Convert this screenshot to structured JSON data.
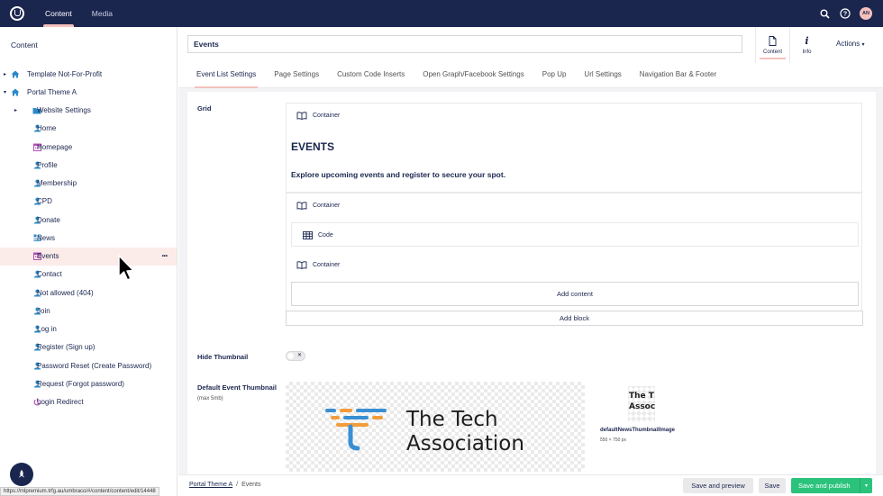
{
  "topbar": {
    "nav": [
      "Content",
      "Media"
    ],
    "avatar_initials": "AN",
    "icons": [
      "search-icon",
      "help-icon"
    ]
  },
  "sidebar": {
    "title": "Content",
    "items": [
      {
        "label": "Template Not-For-Profit",
        "icon": "home-icon",
        "level": 0,
        "caret": true
      },
      {
        "label": "Portal Theme A",
        "icon": "home-icon",
        "level": 0,
        "caret": true,
        "expanded": true
      },
      {
        "label": "Website Settings",
        "icon": "folder-icon",
        "level": 1,
        "caret": true
      },
      {
        "label": "Home",
        "icon": "user-icon",
        "level": 1
      },
      {
        "label": "Homepage",
        "icon": "calendar-icon",
        "level": 1
      },
      {
        "label": "Profile",
        "icon": "user-icon",
        "level": 1
      },
      {
        "label": "Membership",
        "icon": "user-icon",
        "level": 1
      },
      {
        "label": "CPD",
        "icon": "user-icon",
        "level": 1
      },
      {
        "label": "Donate",
        "icon": "user-icon",
        "level": 1
      },
      {
        "label": "News",
        "icon": "news-icon",
        "level": 1
      },
      {
        "label": "Events",
        "icon": "calendar-icon",
        "level": 1,
        "selected": true
      },
      {
        "label": "Contact",
        "icon": "user-icon",
        "level": 1
      },
      {
        "label": "Not allowed (404)",
        "icon": "user-icon",
        "level": 1
      },
      {
        "label": "Join",
        "icon": "user-icon",
        "level": 1
      },
      {
        "label": "Log in",
        "icon": "user-icon",
        "level": 1
      },
      {
        "label": "Register (Sign up)",
        "icon": "user-icon",
        "level": 1
      },
      {
        "label": "Password Reset (Create Password)",
        "icon": "user-icon",
        "level": 1
      },
      {
        "label": "Request (Forgot password)",
        "icon": "user-icon",
        "level": 1
      },
      {
        "label": "Login Redirect",
        "icon": "power-icon",
        "level": 1
      }
    ],
    "status_url": "https://mlpremium.trfg.au/umbraco/#/content/content/edit/14448"
  },
  "header": {
    "name_value": "Events",
    "apps": [
      {
        "label": "Content",
        "icon": "document-icon",
        "active": true
      },
      {
        "label": "Info",
        "icon": "info-icon",
        "active": false
      }
    ],
    "actions_label": "Actions",
    "tabs": [
      "Event List Settings",
      "Page Settings",
      "Custom Code Inserts",
      "Open Graph/Facebook Settings",
      "Pop Up",
      "Url Settings",
      "Navigation Bar & Footer"
    ],
    "active_tab": 0
  },
  "grid": {
    "label": "Grid",
    "container_label": "Container",
    "code_label": "Code",
    "events_title": "EVENTS",
    "events_subtitle": "Explore upcoming events and register to secure your spot.",
    "add_content": "Add content",
    "add_block": "Add block"
  },
  "hide_thumbnail": {
    "label": "Hide Thumbnail",
    "value": false
  },
  "default_thumbnail": {
    "label": "Default Event Thumbnail",
    "hint": "(max 5mb)",
    "logo_line1": "The Tech",
    "logo_line2": "Association",
    "small_line1": "The T",
    "small_line2": "Assoc",
    "file_name": "defaultNewsThumbnailImage",
    "file_size": "550 × 750 px",
    "colors": {
      "bar_orange": "#f39c3c",
      "bar_blue": "#3a8fd4",
      "text": "#1e1e1e"
    }
  },
  "footer": {
    "breadcrumb": [
      "Portal Theme A",
      "Events"
    ],
    "breadcrumb_sep": "/",
    "save_preview": "Save and preview",
    "save": "Save",
    "save_publish": "Save and publish"
  },
  "colors": {
    "navy": "#1b264f",
    "accent_pink": "#f5c1bc",
    "green": "#2bc37c",
    "selected_bg": "#fcece9"
  }
}
